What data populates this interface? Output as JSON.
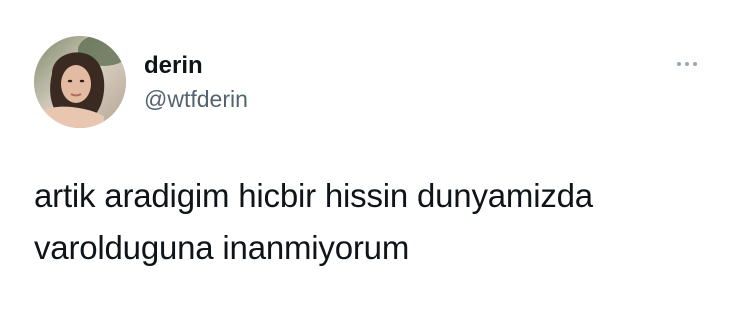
{
  "tweet": {
    "author": {
      "display_name": "derin",
      "handle": "@wtfderin",
      "avatar_icon": "profile-photo"
    },
    "more_icon": "more-horizontal-icon",
    "text_lines": [
      "artik aradigim hicbir hissin dunyamizda",
      "varolduguna inanmiyorum"
    ]
  },
  "colors": {
    "text_primary": "#0f1419",
    "text_secondary": "#536471",
    "background": "#ffffff"
  }
}
